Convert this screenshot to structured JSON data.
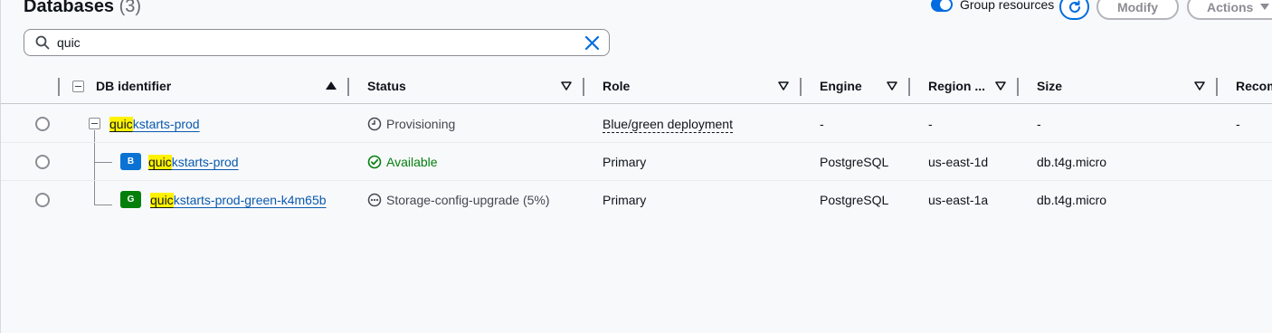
{
  "header": {
    "title": "Databases",
    "count": "(3)",
    "group_resources_label": "Group resources",
    "modify_label": "Modify",
    "actions_label": "Actions"
  },
  "search": {
    "value": "quic"
  },
  "columns": {
    "db_identifier": "DB identifier",
    "status": "Status",
    "role": "Role",
    "engine": "Engine",
    "region": "Region ...",
    "size": "Size",
    "recommendations": "Recom"
  },
  "rows": [
    {
      "id_match": "quic",
      "id_rest": "kstarts-prod",
      "status": "Provisioning",
      "role": "Blue/green deployment",
      "engine": "-",
      "region": "-",
      "size": "-",
      "recommendations": "-"
    },
    {
      "badge": "B",
      "id_match": "quic",
      "id_rest": "kstarts-prod",
      "status": "Available",
      "role": "Primary",
      "engine": "PostgreSQL",
      "region": "us-east-1d",
      "size": "db.t4g.micro"
    },
    {
      "badge": "G",
      "id_match": "quic",
      "id_rest": "kstarts-prod-green-k4m65b",
      "status": "Storage-config-upgrade (5%)",
      "role": "Primary",
      "engine": "PostgreSQL",
      "region": "us-east-1a",
      "size": "db.t4g.micro"
    }
  ],
  "colors": {
    "accent": "#006ce0",
    "link": "#0a5aae",
    "highlight": "#fff200",
    "success": "#037f0c",
    "badge_blue": "#0972d3",
    "badge_green": "#037f0c"
  }
}
